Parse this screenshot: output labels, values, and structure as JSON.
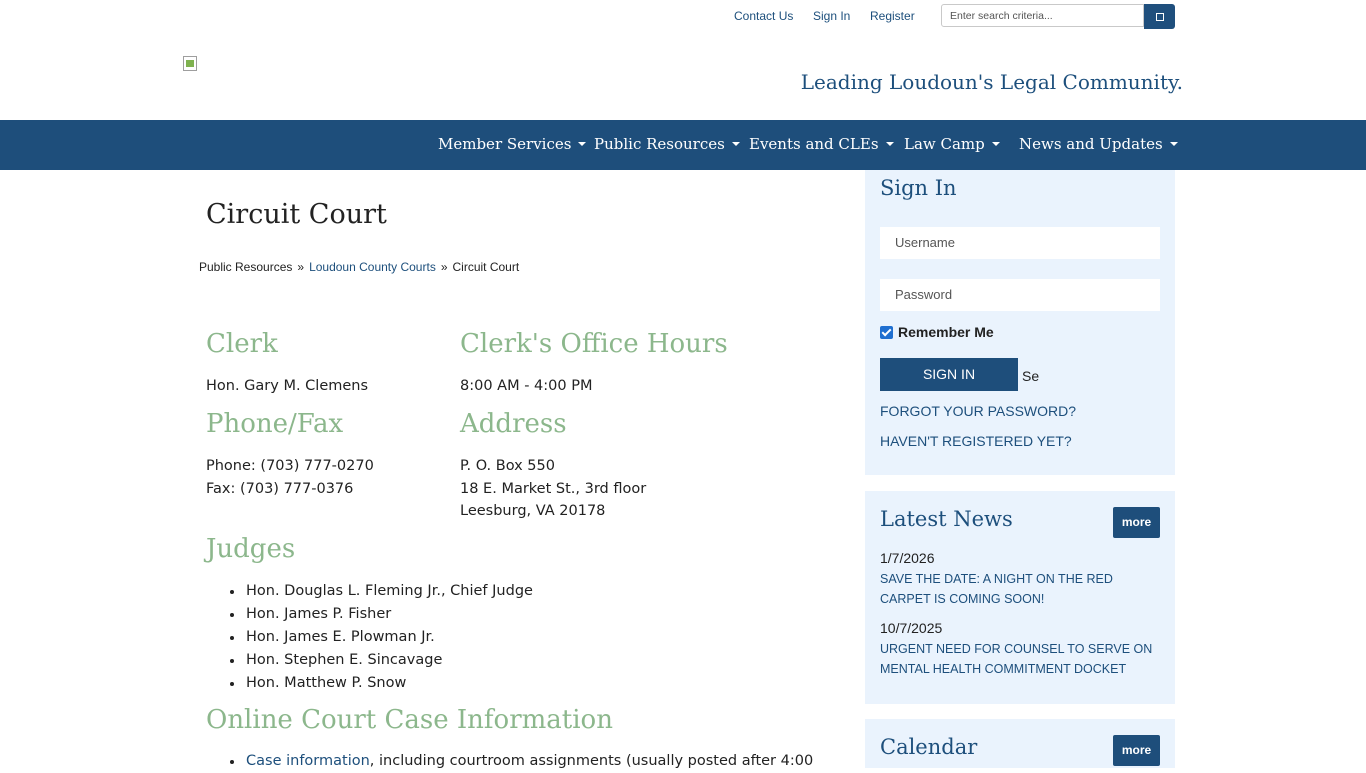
{
  "utility": {
    "contact_label": "Contact Us",
    "signin_label": "Sign In",
    "register_label": "Register",
    "search_placeholder": "Enter search criteria..."
  },
  "header": {
    "tagline": "Leading Loudoun's Legal Community."
  },
  "nav": {
    "items": [
      {
        "label": "Member Services"
      },
      {
        "label": "Public Resources"
      },
      {
        "label": "Events and CLEs"
      },
      {
        "label": "Law Camp"
      },
      {
        "label": "News and Updates"
      }
    ]
  },
  "main": {
    "title": "Circuit Court",
    "breadcrumb": {
      "parent": "Public Resources",
      "link": "Loudoun County Courts",
      "current": "Circuit Court",
      "separator": "»"
    },
    "clerk": {
      "heading": "Clerk",
      "name": "Hon. Gary M. Clemens"
    },
    "hours": {
      "heading": "Clerk's Office Hours",
      "value": "8:00 AM - 4:00 PM"
    },
    "phone": {
      "heading": "Phone/Fax",
      "phone": "Phone: (703) 777-0270",
      "fax": "Fax: (703) 777-0376"
    },
    "address": {
      "heading": "Address",
      "line1": "P. O. Box 550",
      "line2": "18 E. Market St., 3rd floor",
      "line3": "Leesburg, VA 20178"
    },
    "judges": {
      "heading": "Judges",
      "list": [
        "Hon. Douglas L. Fleming Jr., Chief Judge",
        "Hon. James P. Fisher",
        "Hon. James E. Plowman Jr.",
        "Hon. Stephen E. Sincavage",
        "Hon. Matthew P. Snow"
      ]
    },
    "online": {
      "heading": "Online Court Case Information",
      "link": "Case information",
      "text": ", including courtroom assignments (usually posted after 4:00"
    }
  },
  "sidebar": {
    "signin": {
      "title": "Sign In",
      "username_placeholder": "Username",
      "password_placeholder": "Password",
      "remember_label": "Remember Me",
      "button_label": "SIGN IN",
      "trailing_text": "Se",
      "forgot_label": "FORGOT YOUR PASSWORD?",
      "register_label": "HAVEN'T REGISTERED YET?"
    },
    "news": {
      "title": "Latest News",
      "more_label": "more",
      "items": [
        {
          "date": "1/7/2026",
          "title": "SAVE THE DATE: A NIGHT ON THE RED CARPET IS COMING SOON!"
        },
        {
          "date": "10/7/2025",
          "title": "URGENT NEED FOR COUNSEL TO SERVE ON MENTAL HEALTH COMMITMENT DOCKET"
        }
      ]
    },
    "calendar": {
      "title": "Calendar",
      "more_label": "more"
    }
  }
}
